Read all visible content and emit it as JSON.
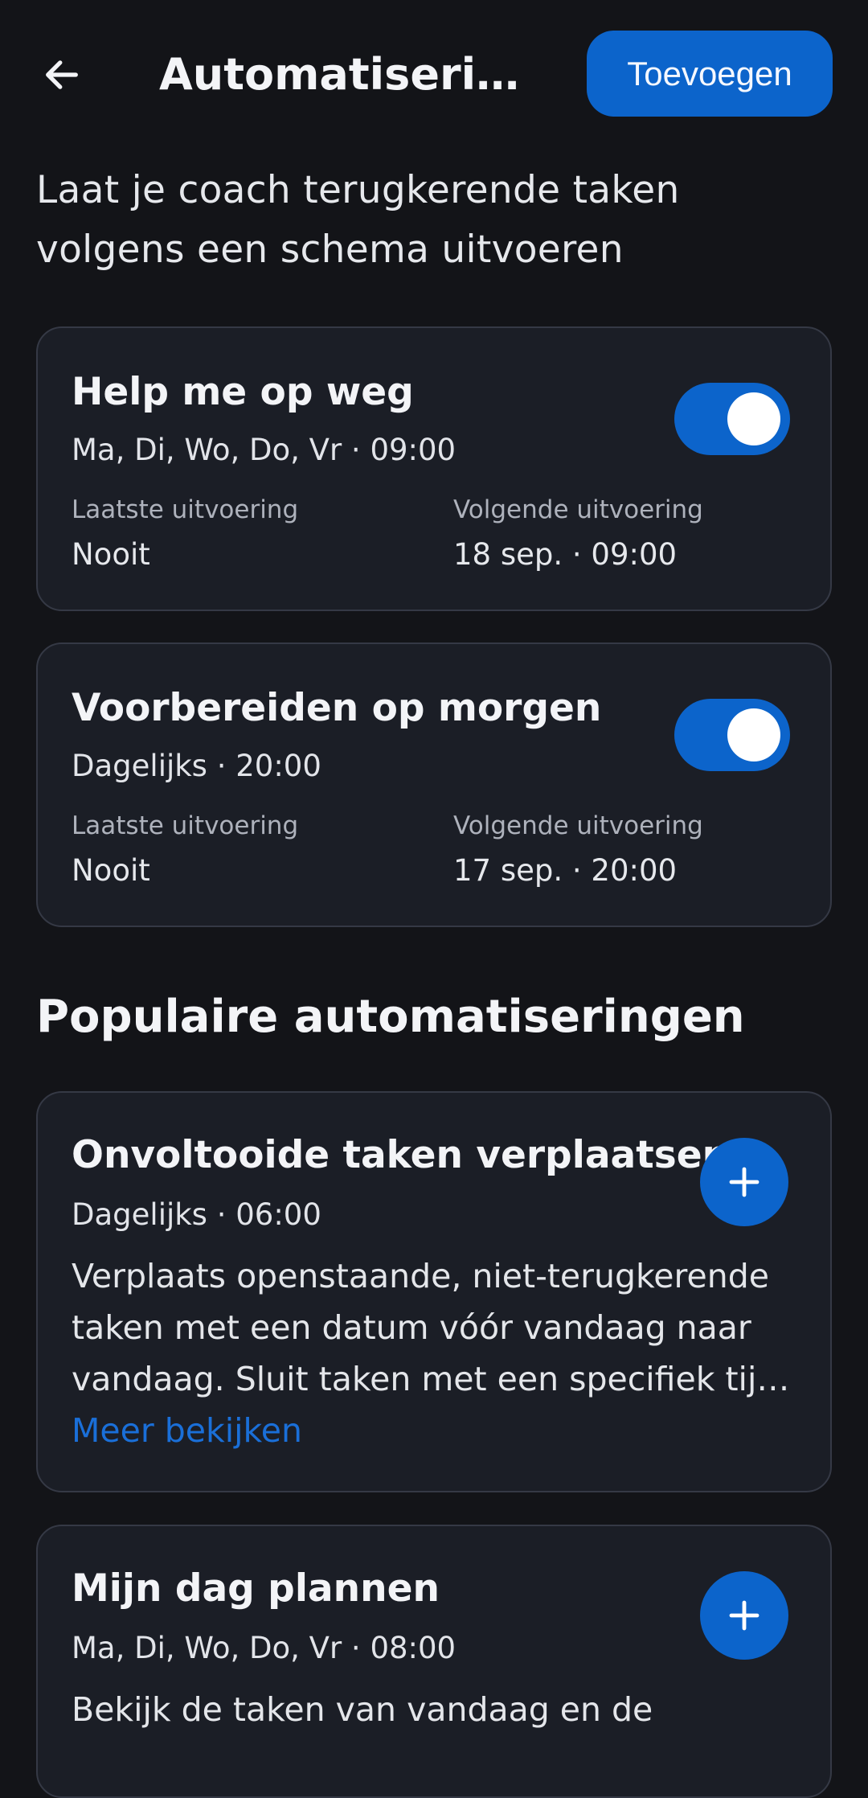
{
  "header": {
    "title": "Automatisering...",
    "add_label": "Toevoegen"
  },
  "intro": "Laat je coach terugkerende taken volgens een schema uitvoeren",
  "automations": [
    {
      "title": "Help me op weg",
      "schedule": "Ma, Di, Wo, Do, Vr · 09:00",
      "last_label": "Laatste uitvoering",
      "last_value": "Nooit",
      "next_label": "Volgende uitvoering",
      "next_value": "18 sep. · 09:00",
      "enabled": true
    },
    {
      "title": "Voorbereiden op morgen",
      "schedule": "Dagelijks · 20:00",
      "last_label": "Laatste uitvoering",
      "last_value": "Nooit",
      "next_label": "Volgende uitvoering",
      "next_value": "17 sep. · 20:00",
      "enabled": true
    }
  ],
  "popular": {
    "section_title": "Populaire automatiseringen",
    "items": [
      {
        "title": "Onvoltooide taken verplaatsen",
        "schedule": "Dagelijks · 06:00",
        "description_lines": [
          "Verplaats openstaande, niet-terugkerende",
          "taken met een datum vóór vandaag naar",
          "vandaag. Sluit taken met een specifiek tijd..."
        ],
        "more_label": "Meer bekijken"
      },
      {
        "title": "Mijn dag plannen",
        "schedule": "Ma, Di, Wo, Do, Vr · 08:00",
        "description_lines": [
          "Bekijk de taken van vandaag en de"
        ]
      }
    ]
  },
  "colors": {
    "background": "#131418",
    "card": "#1b1e26",
    "accent": "#0c64cb",
    "link": "#1a6fd8"
  },
  "icons": {
    "back": "arrow-left-icon",
    "add": "plus-icon"
  }
}
